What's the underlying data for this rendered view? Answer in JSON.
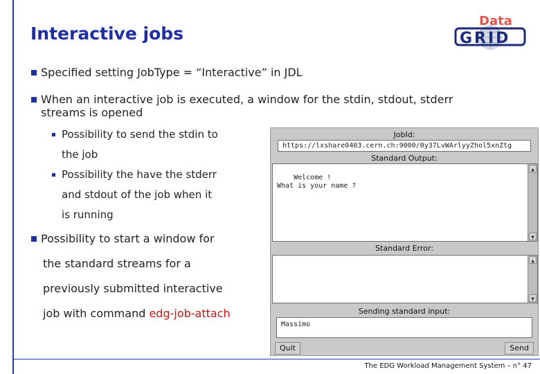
{
  "slide": {
    "title": "Interactive jobs",
    "logo": {
      "line1": "Data",
      "line2": "GRID"
    },
    "b1": {
      "pre": "Specified setting ",
      "code": "JobType = “Interactive” in JDL"
    },
    "b2": {
      "line1": "When an interactive job is executed, a window for the stdin, stdout, stderr",
      "line2": "streams is opened"
    },
    "s1": {
      "line1": "Possibility to send the stdin to",
      "line2": "the job"
    },
    "s2": {
      "line1": "Possibility the have the stderr",
      "line2": "and stdout of the job when it",
      "line3": "is running"
    },
    "b3": {
      "line1": "Possibility to start a window for",
      "line2": "the standard streams for a",
      "line3": "previously submitted interactive",
      "line4_pre": "job with command ",
      "command": "edg-job-attach"
    },
    "footer": "The EDG Workload Management System –  n° 47"
  },
  "window": {
    "jobid_label": "JobId:",
    "jobid_value": "https://lxshare0403.cern.ch:9000/0y37LvWArlyyZhol5xnZtg",
    "stdout_label": "Standard Output:",
    "stdout_text": "Welcome !\nWhat is your name ?",
    "stderr_label": "Standard Error:",
    "stderr_text": "",
    "stdin_label": "Sending standard input:",
    "stdin_value": "Massimo",
    "quit_label": "Quit",
    "send_label": "Send"
  },
  "colors": {
    "accent": "#1f2fa0",
    "command": "#cc1111",
    "window_bg": "#c9c9c9"
  }
}
